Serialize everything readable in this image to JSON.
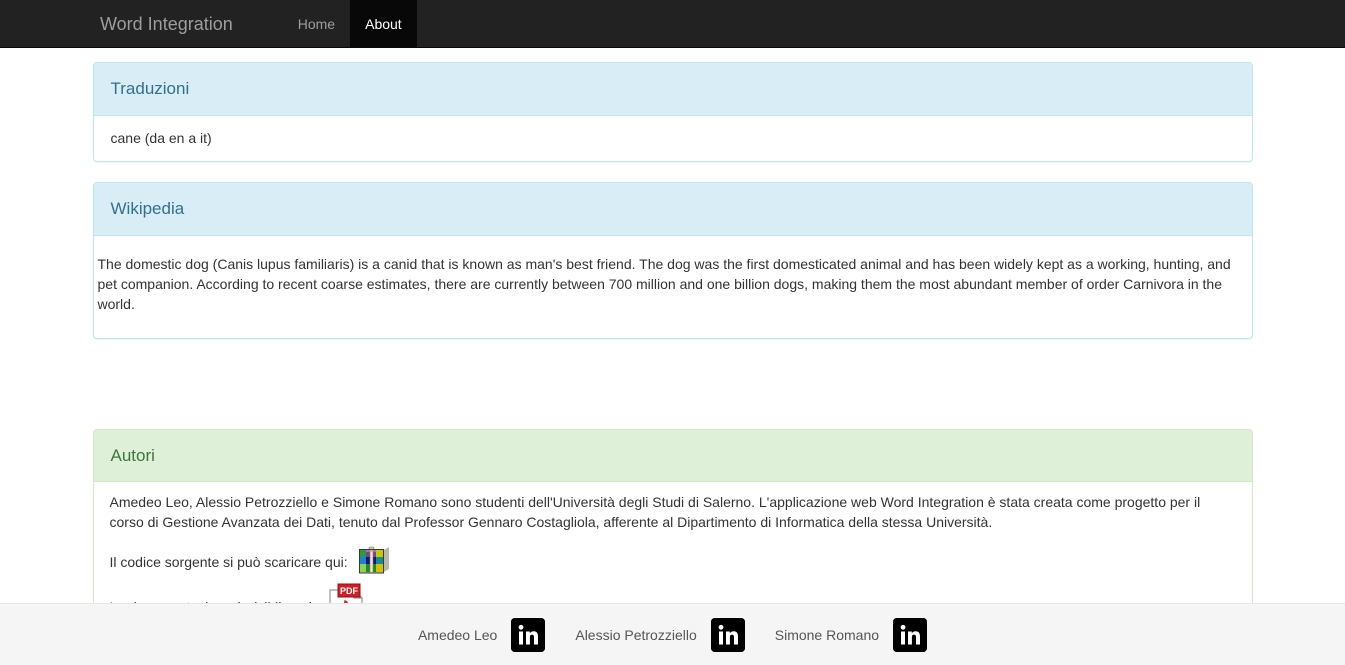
{
  "navbar": {
    "brand": "Word Integration",
    "links": [
      {
        "label": "Home",
        "active": false
      },
      {
        "label": "About",
        "active": true
      }
    ]
  },
  "panels": {
    "traduzioni": {
      "title": "Traduzioni",
      "items": [
        "cane (da en a it)"
      ]
    },
    "wikipedia": {
      "title": "Wikipedia",
      "text": "The domestic dog (Canis lupus familiaris) is a canid that is known as man's best friend. The dog was the first domesticated animal and has been widely kept as a working, hunting, and pet companion. According to recent coarse estimates, there are currently between 700 million and one billion dogs, making them the most abundant member of order Carnivora in the world."
    },
    "autori": {
      "title": "Autori",
      "description": "Amedeo Leo, Alessio Petrozziello e Simone Romano sono studenti dell'Università degli Studi di Salerno. L'applicazione web Word Integration è stata creata come progetto per il corso di Gestione Avanzata dei Dati, tenuto dal Professor Gennaro Costagliola, afferente al Dipartimento di Informatica della stessa Università.",
      "source_label": "Il codice sorgente si può scaricare qui:",
      "source_icon": "rar-archive-icon",
      "docs_label": "La documentazione è visibile qui:",
      "docs_icon": "pdf-file-icon",
      "pdf_icon_text": "PDF"
    }
  },
  "footer": {
    "people": [
      {
        "name": "Amedeo Leo",
        "icon": "linkedin-icon"
      },
      {
        "name": "Alessio Petrozziello",
        "icon": "linkedin-icon"
      },
      {
        "name": "Simone Romano",
        "icon": "linkedin-icon"
      }
    ]
  },
  "colors": {
    "navbar_bg": "#222222",
    "navbar_active_bg": "#080808",
    "info_header_bg": "#d9edf7",
    "info_border": "#bce8f1",
    "info_text": "#31708f",
    "success_header_bg": "#dff0d8",
    "success_border": "#d6e9c6",
    "success_text": "#3c763d",
    "footer_bg": "#f5f5f5",
    "linkedin": "#000000"
  }
}
